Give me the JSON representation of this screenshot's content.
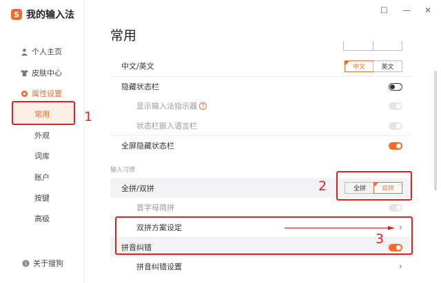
{
  "app": {
    "name": "我的输入法",
    "logo_glyph": "S"
  },
  "window_controls": {
    "feedback": "☐",
    "minimize": "—",
    "close": "✕"
  },
  "sidebar": {
    "items": [
      {
        "label": "个人主页",
        "icon": "user-icon"
      },
      {
        "label": "皮肤中心",
        "icon": "shirt-icon"
      },
      {
        "label": "属性设置",
        "icon": "gear-icon",
        "active": true
      }
    ],
    "sub_items": [
      "常用",
      "外观",
      "词库",
      "账户",
      "按键",
      "高级"
    ],
    "active_sub": "常用",
    "footer": {
      "label": "关于搜狗",
      "icon": "info-icon"
    }
  },
  "page": {
    "title": "常用"
  },
  "settings": {
    "cn_en": {
      "label": "中文/英文",
      "options": [
        "中文",
        "英文"
      ],
      "selected": "中文"
    },
    "hide_status_bar": {
      "label": "隐藏状态栏",
      "on": false
    },
    "show_indicator": {
      "label": "显示输入法指示器",
      "help": "?"
    },
    "embed_lang_bar": {
      "label": "状态栏嵌入语言栏"
    },
    "fullscreen_hide": {
      "label": "全屏隐藏状态栏",
      "on": true
    },
    "section_input": "输入习惯",
    "full_double": {
      "label": "全拼/双拼",
      "options": [
        "全拼",
        "双拼"
      ],
      "selected": "双拼"
    },
    "initial_abbrev": {
      "label": "首字母简拼"
    },
    "double_scheme": {
      "label": "双拼方案设定",
      "chevron": "›"
    },
    "pinyin_correct": {
      "label": "拼音纠错",
      "on": true
    },
    "pinyin_correct_settings": {
      "label": "拼音纠错设置",
      "chevron": "›"
    }
  },
  "annotations": {
    "n1": "1",
    "n2": "2",
    "n3": "3"
  },
  "colors": {
    "accent": "#f26b2a",
    "annotation": "#e02020"
  }
}
